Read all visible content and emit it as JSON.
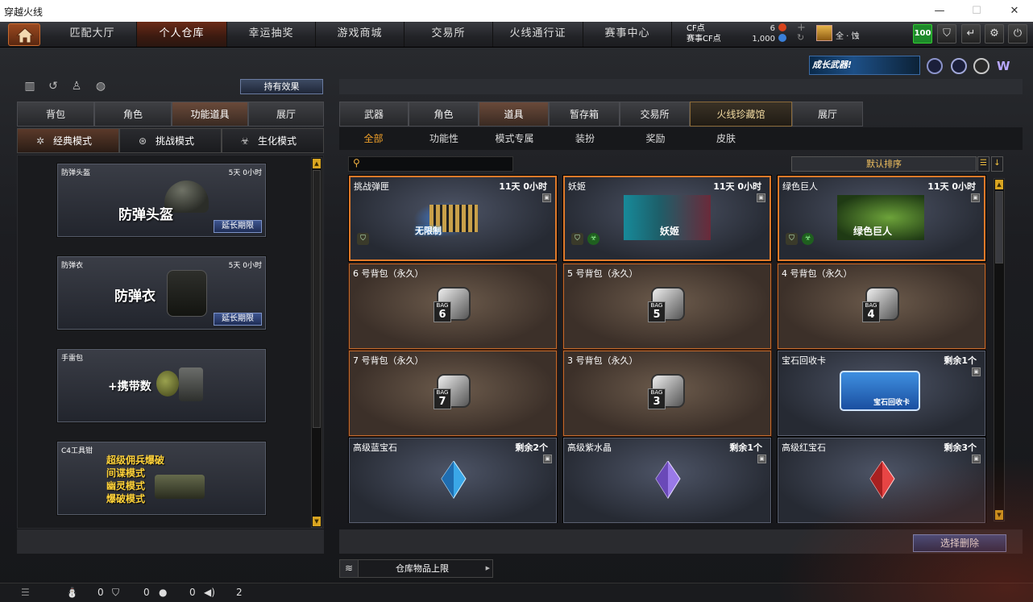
{
  "window": {
    "title": "穿越火线"
  },
  "nav": {
    "tabs": [
      "匹配大厅",
      "个人仓库",
      "幸运抽奖",
      "游戏商城",
      "交易所",
      "火线通行证",
      "赛事中心"
    ],
    "active": "个人仓库",
    "cf_label": "CF点",
    "cf_value": "6",
    "match_cf_label": "赛事CF点",
    "match_cf_value": "1,000",
    "user_name": "全 · 蚀",
    "level_badge": "100"
  },
  "promo": {
    "text": "成长武器!"
  },
  "left": {
    "hold_effect_label": "持有效果",
    "tabs": [
      "背包",
      "角色",
      "功能道具",
      "展厅"
    ],
    "active_tab": "功能道具",
    "modes": [
      "经典模式",
      "挑战模式",
      "生化模式"
    ],
    "active_mode": "经典模式",
    "items": [
      {
        "name": "防弹头盔",
        "time": "5天 0小时",
        "big": "防弹头盔",
        "extend": "延长期限"
      },
      {
        "name": "防弹衣",
        "time": "5天 0小时",
        "big": "防弹衣",
        "extend": "延长期限"
      },
      {
        "name": "手雷包",
        "time": "",
        "big": "+携带数",
        "extend": ""
      },
      {
        "name": "C4工具钳",
        "time": "",
        "lines": [
          "超级佣兵爆破",
          "间谍模式",
          "幽灵模式",
          "爆破模式"
        ],
        "extend": ""
      }
    ]
  },
  "right": {
    "tabs": [
      "武器",
      "角色",
      "道具",
      "暂存箱",
      "交易所",
      "火线珍藏馆",
      "展厅"
    ],
    "active_tab": "道具",
    "subtabs": [
      "全部",
      "功能性",
      "模式专属",
      "装扮",
      "奖励",
      "皮肤"
    ],
    "active_subtab": "全部",
    "search_placeholder": "",
    "sort_label": "默认排序",
    "items": [
      {
        "name": "挑战弹匣",
        "time": "11天 0小时",
        "art_text": "无限制",
        "kind": "blue"
      },
      {
        "name": "妖姬",
        "time": "11天 0小时",
        "art_text": "妖姬",
        "kind": "blue"
      },
      {
        "name": "绿色巨人",
        "time": "11天 0小时",
        "art_text": "绿色巨人",
        "kind": "blue"
      },
      {
        "name": "6 号背包（永久）",
        "time": "",
        "bag": "6",
        "kind": "bag"
      },
      {
        "name": "5 号背包（永久）",
        "time": "",
        "bag": "5",
        "kind": "bag"
      },
      {
        "name": "4 号背包（永久）",
        "time": "",
        "bag": "4",
        "kind": "bag"
      },
      {
        "name": "7 号背包（永久）",
        "time": "",
        "bag": "7",
        "kind": "bag"
      },
      {
        "name": "3 号背包（永久）",
        "time": "",
        "bag": "3",
        "kind": "bag"
      },
      {
        "name": "宝石回收卡",
        "time": "剩余1个",
        "art_text": "宝石回收卡",
        "kind": "blue"
      },
      {
        "name": "高级蓝宝石",
        "time": "剩余2个",
        "gem": "#3aa7e8",
        "kind": "blue"
      },
      {
        "name": "高级紫水晶",
        "time": "剩余1个",
        "gem": "#9a7ae8",
        "kind": "blue"
      },
      {
        "name": "高级红宝石",
        "time": "剩余3个",
        "gem": "#e84545",
        "kind": "blue"
      }
    ],
    "delete_label": "选择删除",
    "capacity_label": "仓库物品上限",
    "bag_label": "BAG"
  },
  "statusbar": {
    "a": "0",
    "b": "0",
    "c": "0",
    "d": "2"
  }
}
